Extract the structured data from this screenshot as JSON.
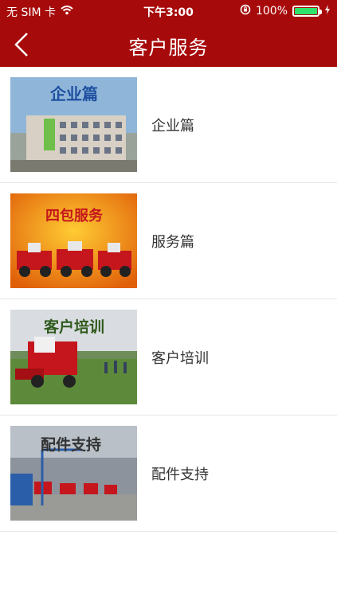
{
  "status": {
    "carrier": "无 SIM 卡",
    "time": "下午3:00",
    "battery_pct": "100%",
    "battery_level": 1.0,
    "accent_battery": "#2ee36c"
  },
  "nav": {
    "title": "客户服务",
    "back_icon": "chevron-left-icon",
    "bar_color": "#a70a0a"
  },
  "items": [
    {
      "label": "企业篇",
      "image_caption": "企业篇"
    },
    {
      "label": "服务篇",
      "image_caption": "四包服务"
    },
    {
      "label": "客户培训",
      "image_caption": "客户培训"
    },
    {
      "label": "配件支持",
      "image_caption": "配件支持"
    }
  ]
}
